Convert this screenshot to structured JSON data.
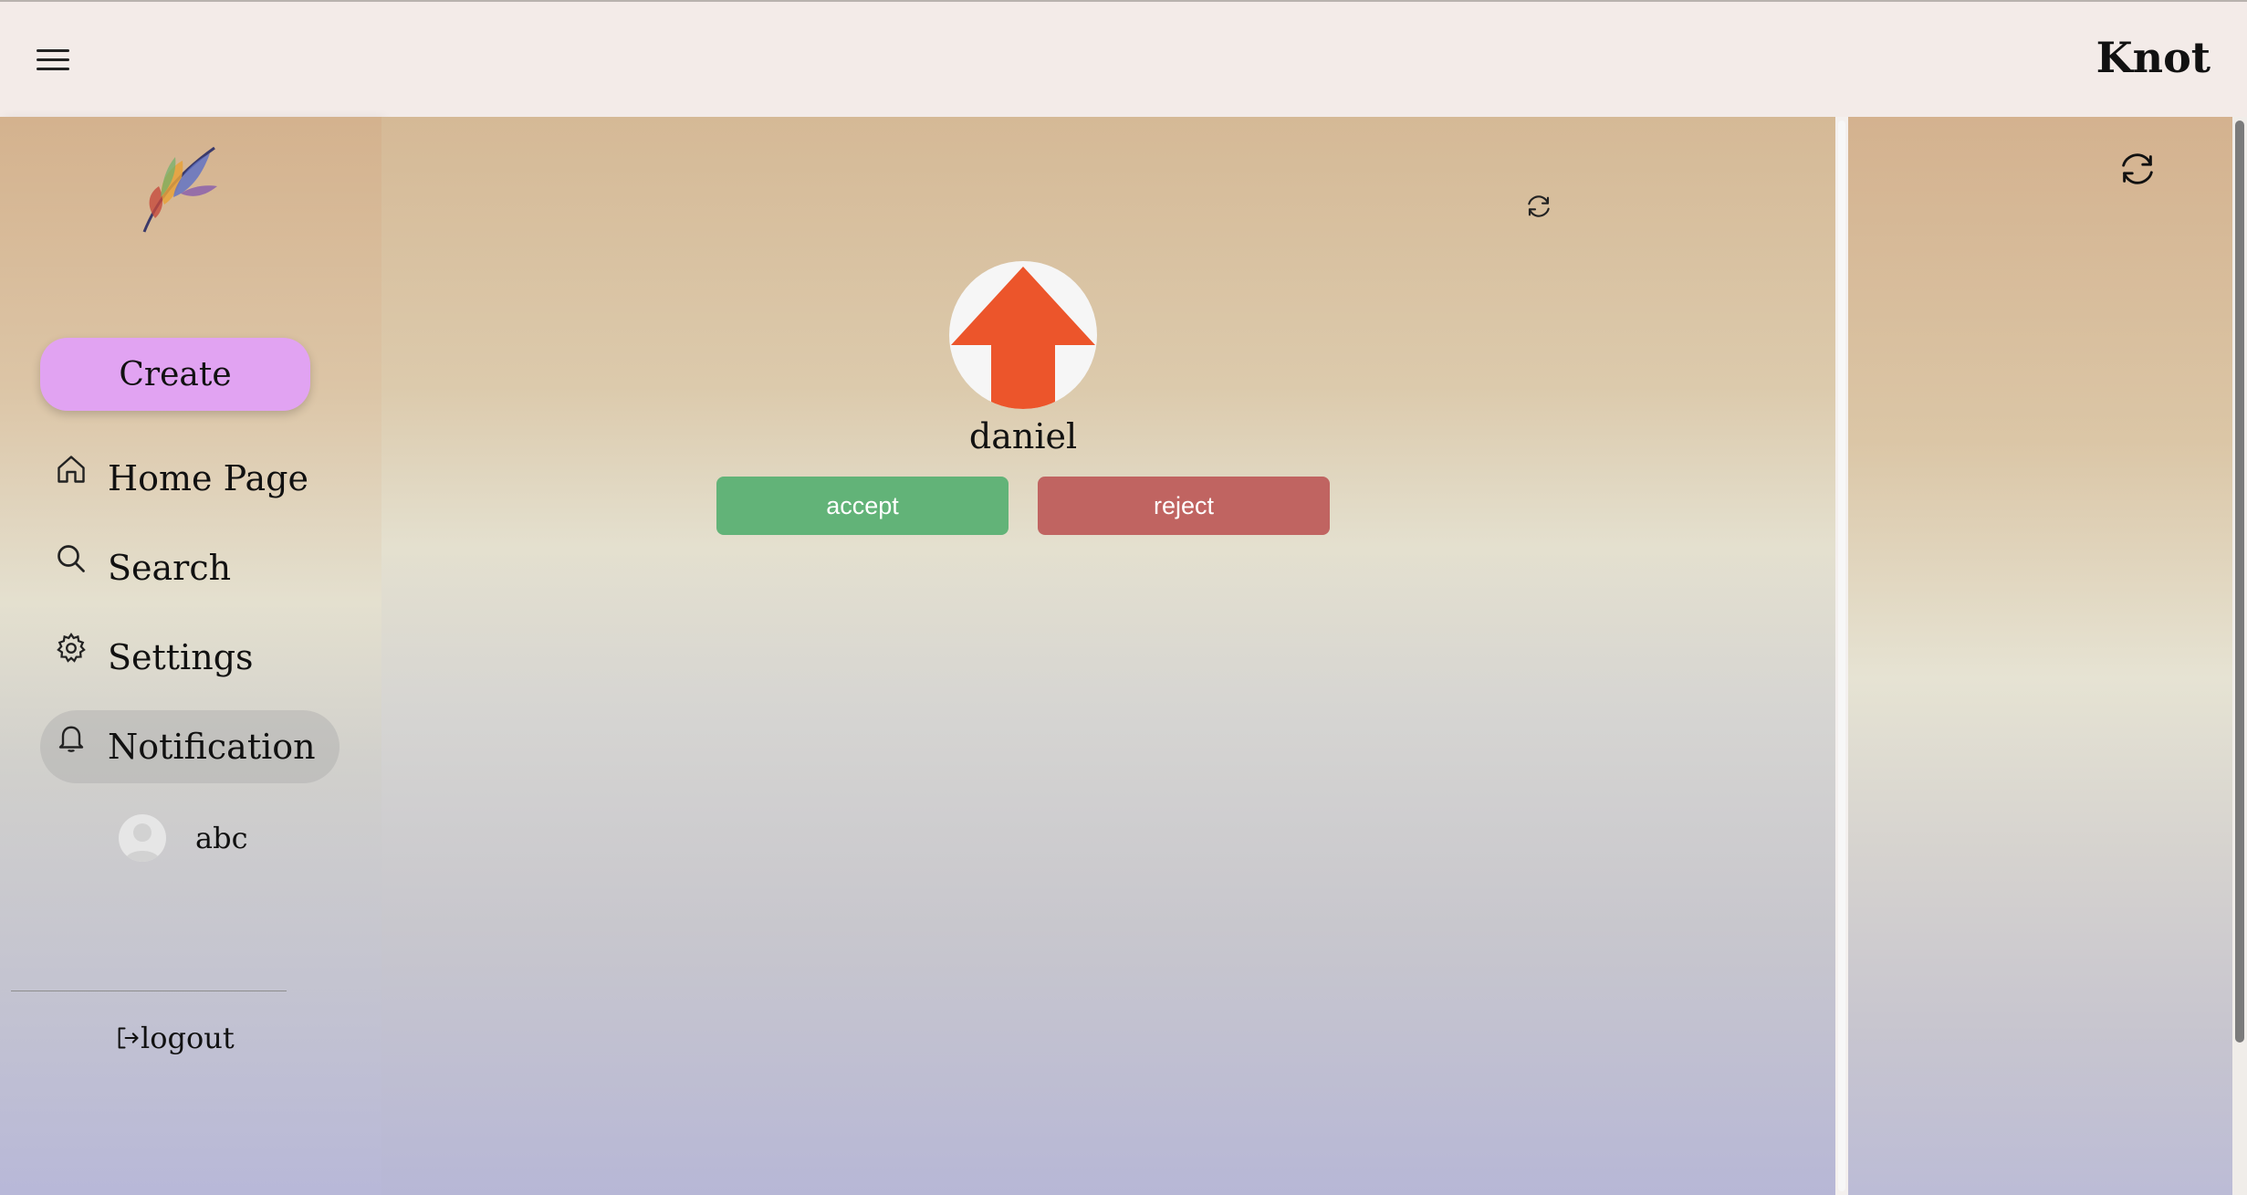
{
  "header": {
    "brand": "Knot",
    "menu_icon": "hamburger-menu-icon"
  },
  "sidebar": {
    "logo_icon": "feather-logo-icon",
    "create_label": "Create",
    "items": [
      {
        "label": "Home Page",
        "icon": "home-icon",
        "active": false
      },
      {
        "label": "Search",
        "icon": "search-icon",
        "active": false
      },
      {
        "label": "Settings",
        "icon": "gear-icon",
        "active": false
      },
      {
        "label": "Notification",
        "icon": "bell-icon",
        "active": true
      }
    ],
    "user": {
      "name": "abc",
      "avatar_icon": "default-avatar-icon"
    },
    "logout_label": "logout",
    "logout_icon": "logout-arrow-icon"
  },
  "main": {
    "refresh_icon": "refresh-icon",
    "request": {
      "name": "daniel",
      "avatar_icon": "upload-arrow-avatar-icon",
      "accept_label": "accept",
      "reject_label": "reject"
    }
  },
  "right_panel": {
    "refresh_icon": "refresh-icon"
  },
  "colors": {
    "create_button": "#e1a3f2",
    "accept_button": "#62b378",
    "reject_button": "#c06461",
    "avatar_arrow": "#ec552b",
    "active_nav": "#b4b4b0"
  }
}
